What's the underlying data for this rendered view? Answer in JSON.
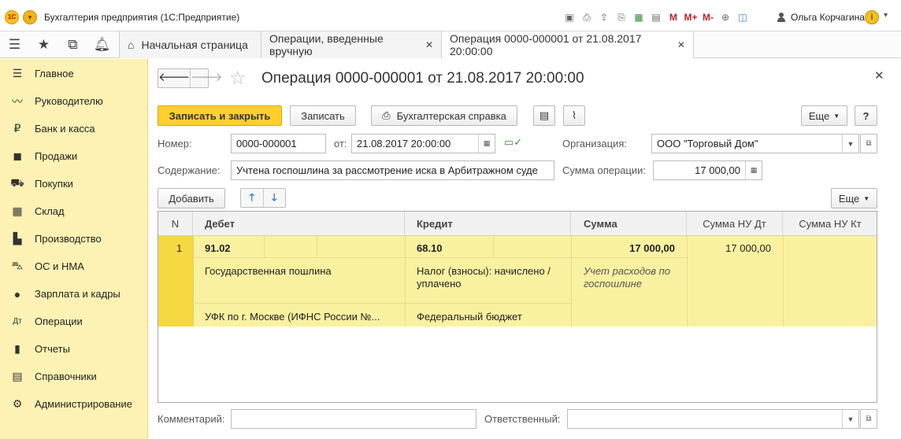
{
  "titlebar": {
    "logo_text": "1С",
    "title": "Бухгалтерия предприятия  (1С:Предприятие)",
    "user": "Ольга Корчагина",
    "tools": [
      "save-icon",
      "print-icon",
      "upload-icon",
      "printer-icon",
      "calculator-icon",
      "calendar-icon",
      "M",
      "M+",
      "M-",
      "zoom-icon",
      "window-icon"
    ]
  },
  "tabs": {
    "home": "Начальная страница",
    "ops": "Операции, введенные вручную",
    "active": "Операция 0000-000001 от 21.08.2017 20:00:00",
    "close": "✕"
  },
  "sidebar": {
    "items": [
      {
        "label": "Главное",
        "icon": "menu-icon"
      },
      {
        "label": "Руководителю",
        "icon": "trend-icon"
      },
      {
        "label": "Банк и касса",
        "icon": "ruble-icon"
      },
      {
        "label": "Продажи",
        "icon": "bag-icon"
      },
      {
        "label": "Покупки",
        "icon": "cart-icon"
      },
      {
        "label": "Склад",
        "icon": "grid-icon"
      },
      {
        "label": "Производство",
        "icon": "factory-icon"
      },
      {
        "label": "ОС и НМА",
        "icon": "truck-icon"
      },
      {
        "label": "Зарплата и кадры",
        "icon": "person-icon"
      },
      {
        "label": "Операции",
        "icon": "dtkt-icon"
      },
      {
        "label": "Отчеты",
        "icon": "bars-icon"
      },
      {
        "label": "Справочники",
        "icon": "book-icon"
      },
      {
        "label": "Администрирование",
        "icon": "gear-icon"
      }
    ]
  },
  "document": {
    "title": "Операция 0000-000001 от 21.08.2017 20:00:00",
    "toolbar": {
      "save_close": "Записать и закрыть",
      "save": "Записать",
      "report": "Бухгалтерская справка",
      "more": "Еще",
      "help": "?"
    },
    "fields": {
      "number_label": "Номер:",
      "number": "0000-000001",
      "date_label": "от:",
      "date": "21.08.2017 20:00:00",
      "org_label": "Организация:",
      "org": "ООО \"Торговый Дом\"",
      "content_label": "Содержание:",
      "content": "Учтена госпошлина за рассмотрение иска в Арбитражном суде",
      "sum_label": "Сумма операции:",
      "sum": "17 000,00"
    },
    "table_toolbar": {
      "add": "Добавить",
      "more": "Еще"
    },
    "table": {
      "columns": [
        "N",
        "Дебет",
        "Кредит",
        "Сумма",
        "Сумма НУ Дт",
        "Сумма НУ Кт"
      ],
      "rows": [
        {
          "n": "1",
          "debit_account": "91.02",
          "debit_sub1": "Государственная пошлина",
          "debit_sub2": "УФК по г. Москве (ИФНС России №...",
          "credit_account": "68.10",
          "credit_sub1_line1": "Налог (взносы): начислено /",
          "credit_sub1_line2": "уплачено",
          "credit_sub2": "Федеральный бюджет",
          "amount": "17 000,00",
          "amount_note_line1": "Учет расходов по",
          "amount_note_line2": "госпошлине",
          "amount_nu_dt": "17 000,00",
          "amount_nu_kt": ""
        }
      ]
    },
    "footer": {
      "comment_label": "Комментарий:",
      "comment": "",
      "responsible_label": "Ответственный:",
      "responsible": ""
    }
  }
}
